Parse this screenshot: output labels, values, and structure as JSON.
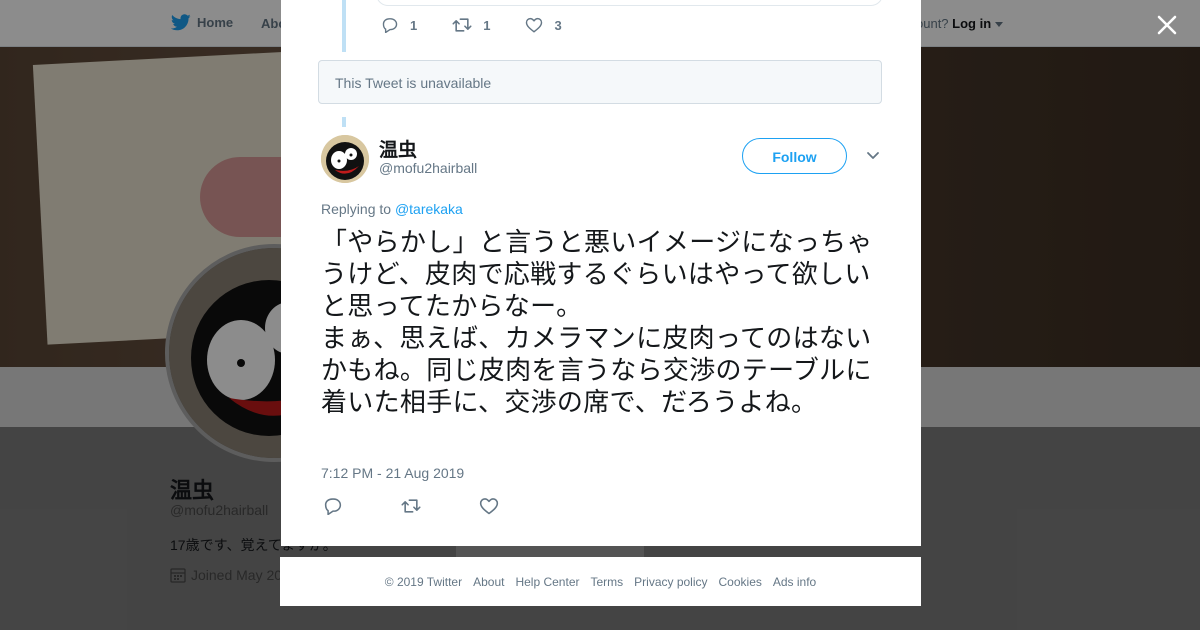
{
  "nav": {
    "home_label": "Home",
    "about_label": "Abo",
    "have_account_label": "ccount?",
    "login_label": "Log in"
  },
  "profile": {
    "name": "温虫",
    "handle": "@mofu2hairball",
    "bio": "17歳です、覚えてますか。",
    "joined": "Joined May 20"
  },
  "previous_tweet": {
    "reply_count": "1",
    "retweet_count": "1",
    "like_count": "3"
  },
  "unavailable_text": "This Tweet is unavailable",
  "tweet": {
    "author_name": "温虫",
    "author_handle": "@mofu2hairball",
    "follow_label": "Follow",
    "replying_to_label": "Replying to",
    "replying_to_handle": "@tarekaka",
    "text": "「やらかし」と言うと悪いイメージになっちゃうけど、皮肉で応戦するぐらいはやって欲しいと思ってたからなー。\nまぁ、思えば、カメラマンに皮肉ってのはないかもね。同じ皮肉を言うなら交渉のテーブルに着いた相手に、交渉の席で、だろうよね。",
    "timestamp": "7:12 PM - 21 Aug 2019"
  },
  "footer": {
    "copyright": "© 2019 Twitter",
    "links": [
      "About",
      "Help Center",
      "Terms",
      "Privacy policy",
      "Cookies",
      "Ads info"
    ]
  },
  "colors": {
    "accent": "#1da1f2",
    "muted": "#657786",
    "text": "#14171a"
  },
  "icons": [
    "twitter-bird-icon",
    "caret-down-icon",
    "close-icon",
    "reply-icon",
    "retweet-icon",
    "like-icon",
    "calendar-icon"
  ]
}
